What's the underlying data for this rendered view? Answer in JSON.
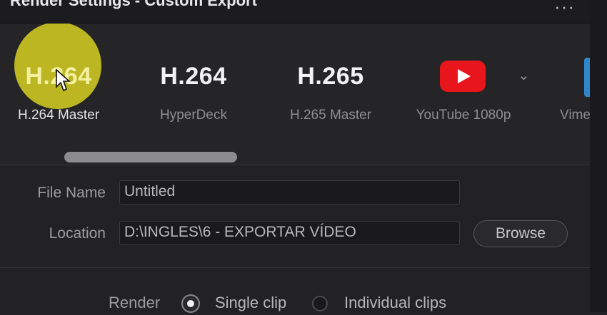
{
  "window": {
    "title": "Render Settings - Custom Export",
    "more_icon": "more-horizontal-icon"
  },
  "presets": [
    {
      "big": "H.264",
      "label": "H.264 Master",
      "selected": true
    },
    {
      "big": "H.264",
      "label": "HyperDeck"
    },
    {
      "big": "H.265",
      "label": "H.265 Master"
    },
    {
      "icon": "youtube-icon",
      "label": "YouTube 1080p",
      "has_dropdown": true
    },
    {
      "label": "Vime"
    }
  ],
  "colors": {
    "highlight": "#d0cb20",
    "youtube": "#e8161c",
    "accent": "#2f86c9"
  },
  "form": {
    "file_name_label": "File Name",
    "file_name_value": "Untitled",
    "location_label": "Location",
    "location_value": "D:\\INGLES\\6 - EXPORTAR VÍDEO",
    "browse_label": "Browse"
  },
  "render": {
    "label": "Render",
    "option_single": "Single clip",
    "option_individual": "Individual clips",
    "selected": "Single clip"
  }
}
